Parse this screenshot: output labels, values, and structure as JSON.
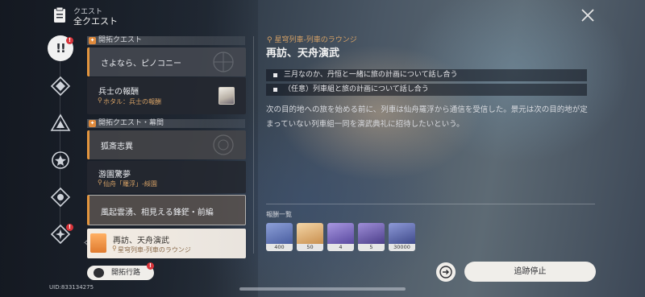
{
  "header": {
    "subtitle": "クエスト",
    "title": "全クエスト",
    "icons": [
      "quest-book-icon",
      "close-icon"
    ]
  },
  "rail": {
    "active_label": "!!",
    "badges": [
      "!",
      "!"
    ],
    "items": [
      "all-quests-icon",
      "trailblaze-icon",
      "companion-icon",
      "adventure-icon",
      "daily-icon",
      "event-icon",
      "locator-icon"
    ]
  },
  "sections": [
    {
      "label": "開拓クエスト",
      "mark": "✦"
    },
    {
      "label": "開拓クエスト・幕間",
      "mark": "✦"
    }
  ],
  "quests": [
    {
      "title": "さよなら、ピノコニー",
      "location": ""
    },
    {
      "title": "兵士の報酬",
      "location": "ホタル：兵士の報酬"
    },
    {
      "title": "狐斎志異",
      "location": ""
    },
    {
      "title": "游園驚夢",
      "location": "仙舟「羅浮」-綏園"
    },
    {
      "title": "風起雲湧、相見える鋒鋩・前編",
      "location": ""
    },
    {
      "title": "再訪、天舟演武",
      "location": "星穹列車-列車のラウンジ"
    }
  ],
  "trailblaze_button": "開拓行路",
  "trailblaze_badge": "!",
  "uid": "UID:833134275",
  "detail": {
    "location": "星穹列車-列車のラウンジ",
    "title": "再訪、天舟演武",
    "objectives": [
      "三月なのか、丹恒と一緒に旅の計画について話し合う",
      "（任意）列車組と旅の計画について話し合う"
    ],
    "description": "次の目的地への旅を始める前に、列車は仙舟羅浮から通信を受信した。景元は次の目的地が定まっていない列車組一同を演武典礼に招待したいという。",
    "rewards_label": "報酬一覧",
    "rewards": [
      {
        "count": "400",
        "color": "#5a6ea8"
      },
      {
        "count": "50",
        "color": "#c9904f"
      },
      {
        "count": "4",
        "color": "#6b5aa8"
      },
      {
        "count": "5",
        "color": "#5e4f9a"
      },
      {
        "count": "30000",
        "color": "#4b5796"
      }
    ]
  },
  "buttons": {
    "stop_tracking": "追跡停止"
  }
}
